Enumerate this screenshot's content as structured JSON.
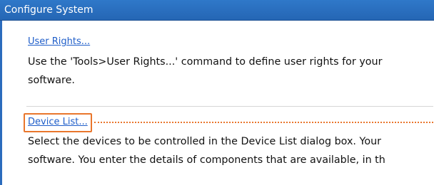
{
  "window": {
    "title": "Configure System"
  },
  "sections": [
    {
      "link": "User Rights...",
      "desc_line1": "Use the 'Tools>User Rights...' command to define user rights for your",
      "desc_line2": "software."
    },
    {
      "link": "Device List...",
      "desc_line1": "Select the devices to be controlled in the Device List dialog box. Your",
      "desc_line2": "software. You enter the details of components that are available, in th"
    }
  ],
  "colors": {
    "titlebar": "#2b6cbd",
    "link": "#1f5ec9",
    "callout": "#e9762c"
  }
}
